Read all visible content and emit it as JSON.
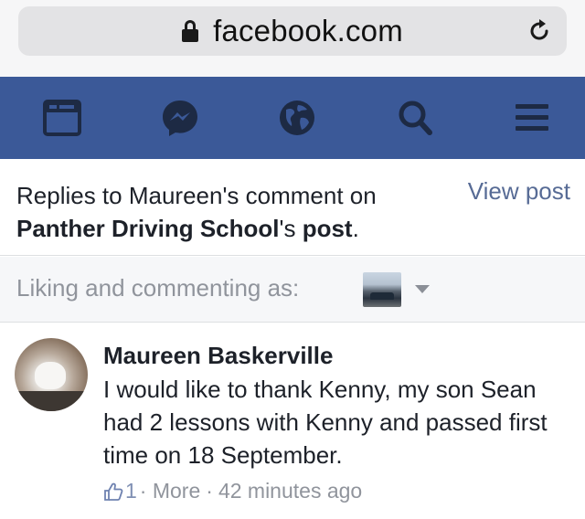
{
  "browser": {
    "url": "facebook.com"
  },
  "nav": {
    "items": [
      "feed-icon",
      "messenger-icon",
      "globe-icon",
      "search-icon",
      "menu-icon"
    ]
  },
  "header": {
    "prefix": "Replies to Maureen's comment on",
    "page_name": "Panther Driving School",
    "suffix_possessive": "'s ",
    "suffix_post": "post",
    "suffix_end": ".",
    "view_post_label": "View post"
  },
  "liking": {
    "label": "Liking and commenting as:"
  },
  "comment": {
    "author": "Maureen Baskerville",
    "text": "I would like to thank Kenny, my son Sean had 2 lessons with Kenny and passed first time on 18 September.",
    "like_count": "1",
    "separator": "·",
    "more_label": "More",
    "timestamp": "42 minutes ago"
  },
  "colors": {
    "nav_bg": "#3b5998",
    "link": "#576b95",
    "meta": "#90949c"
  }
}
